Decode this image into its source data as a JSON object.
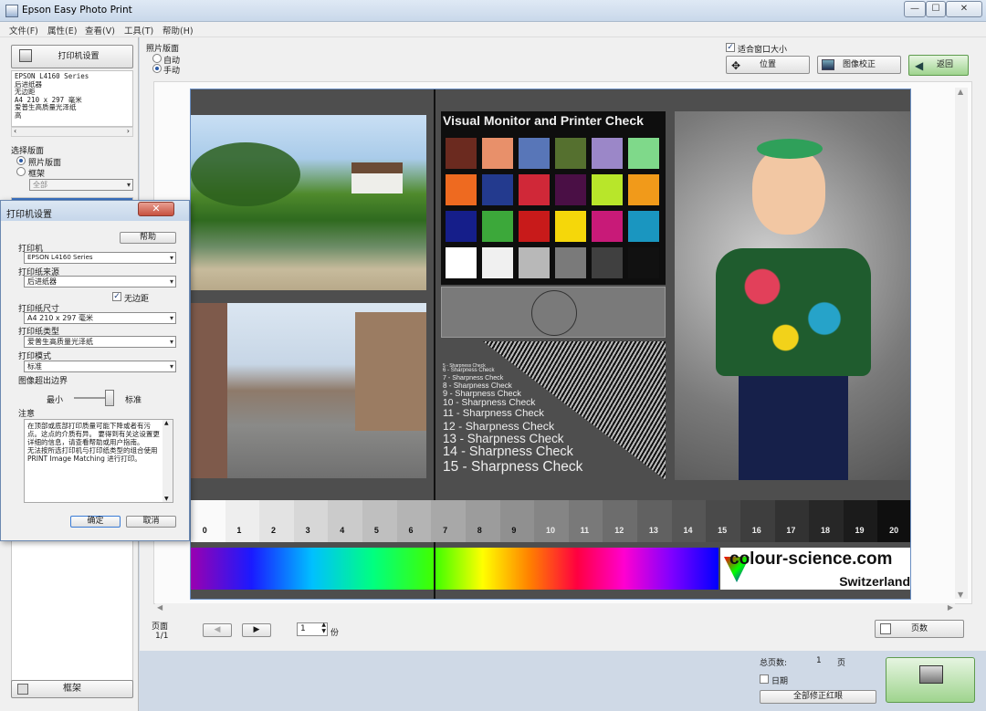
{
  "window": {
    "title": "Epson Easy Photo Print",
    "btn_min": "—",
    "btn_max": "☐",
    "btn_close": "✕"
  },
  "menu": [
    "文件(F)",
    "属性(E)",
    "查看(V)",
    "工具(T)",
    "帮助(H)"
  ],
  "left": {
    "printer_settings_button": "打印机设置",
    "printer_info": [
      "EPSON L4160 Series",
      "后进纸器",
      "无边距",
      "A4 210 x 297 毫米",
      "爱普生高质量光泽纸",
      "高"
    ],
    "select_page_label": "选择版面",
    "radio_photo_layout": "照片版面",
    "radio_frame": "框架",
    "all_dropdown": "全部",
    "frame_button": "框架"
  },
  "main": {
    "photo_layout_label": "照片版面",
    "radio_auto": "自动",
    "radio_manual": "手动",
    "fit_window_label": "适合窗口大小",
    "position_button": "位置",
    "image_correct_button": "图像校正",
    "back_button": "返回",
    "page_label": "页面",
    "page_value": "1/1",
    "copies_value": "1",
    "copies_unit": "份",
    "pages_button": "页数",
    "total_pages_label": "总页数:",
    "total_pages_value": "1",
    "total_pages_unit": "页",
    "date_label": "日期",
    "correct_all_button": "全部修正红眼"
  },
  "photo": {
    "chart_title": "Visual Monitor and Printer Check",
    "sharpness": [
      "5 - Sharpness Check",
      "6 - Sharpness Check",
      "7 - Sharpness Check",
      "8 - Sharpness Check",
      "9 - Sharpness Check",
      "10 - Sharpness Check",
      "11 - Sharpness Check",
      "12 - Sharpness Check",
      "13 - Sharpness Check",
      "14 - Sharpness Check",
      "15 - Sharpness Check"
    ],
    "gray_numbers": [
      "0",
      "1",
      "2",
      "3",
      "4",
      "5",
      "6",
      "7",
      "8",
      "9",
      "10",
      "11",
      "12",
      "13",
      "14",
      "15",
      "16",
      "17",
      "18",
      "19",
      "20"
    ],
    "brand": "colour-science.com",
    "country": "Switzerland"
  },
  "dialog": {
    "title": "打印机设置",
    "close": "✕",
    "help_button": "帮助",
    "printer_label": "打印机",
    "printer_value": "EPSON L4160 Series",
    "source_label": "打印纸来源",
    "source_value": "后进纸器",
    "borderless_label": "无边距",
    "size_label": "打印纸尺寸",
    "size_value": "A4 210 x 297 毫米",
    "type_label": "打印纸类型",
    "type_value": "爱普生高质量光泽纸",
    "mode_label": "打印模式",
    "mode_value": "标准",
    "expansion_label": "图像超出边界",
    "min_label": "最小",
    "std_label": "标准",
    "notes_label": "注意",
    "notes_text": "在顶部或底部打印质量可能下降或者有污点。这点的介质有异。 要得到有关这设置更详细的信息，请查看帮助或用户指南。\n无法按所选打印机与打印纸类型的组合使用 PRINT Image Matching 进行打印。",
    "ok_button": "确定",
    "cancel_button": "取消"
  },
  "colors": {
    "swatches": [
      "#6b2a1f",
      "#e8906a",
      "#5876b8",
      "#55702f",
      "#9b87c8",
      "#7fd98a",
      "#ee6a20",
      "#233a8e",
      "#d02838",
      "#4a0f45",
      "#b8e62a",
      "#f19a1a",
      "#151e8a",
      "#3ca83a",
      "#c81a1a",
      "#f5d70a",
      "#c81a78",
      "#1a96c0",
      "#ffffff",
      "#f0f0f0",
      "#b8b8b8",
      "#7a7a7a",
      "#404040",
      "#111111"
    ]
  }
}
